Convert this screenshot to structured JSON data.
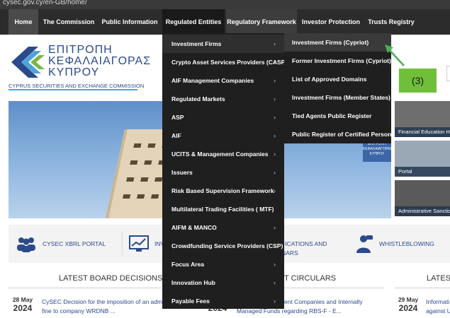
{
  "browser": {
    "url": "cysec.gov.cy/en-GB/home/"
  },
  "nav": {
    "items": [
      {
        "label": "Home"
      },
      {
        "label": "The Commission"
      },
      {
        "label": "Public Information"
      },
      {
        "label": "Regulated Entities"
      },
      {
        "label": "Regulatory Framework"
      },
      {
        "label": "Investor Protection"
      },
      {
        "label": "Trusts Registry"
      }
    ]
  },
  "logo": {
    "greek_line1": "ΕΠΙΤΡΟΠΗ",
    "greek_line2": "ΚΕΦΑΛΑΙΑΓΟΡΑΣ",
    "greek_line3": "ΚΥΠΡΟΥ",
    "english": "CYPRUS SECURITIES AND EXCHANGE COMMISSION",
    "colors": {
      "blue": "#2a4a8c",
      "green": "#7ab648",
      "light_blue": "#4fa3d8"
    }
  },
  "dropdown": {
    "items": [
      {
        "label": "Investment Firms",
        "chevron": "›"
      },
      {
        "label": "Crypto Asset Services Providers (CASP)",
        "chevron": "›"
      },
      {
        "label": "AIF Management Companies",
        "chevron": "›"
      },
      {
        "label": "Regulated Markets",
        "chevron": "›"
      },
      {
        "label": "ASP",
        "chevron": "›"
      },
      {
        "label": "AIF",
        "chevron": "›"
      },
      {
        "label": "UCITS & Management Companies",
        "chevron": "›"
      },
      {
        "label": "Issuers",
        "chevron": "›"
      },
      {
        "label": "Risk Based Supervision Framework",
        "chevron": "›"
      },
      {
        "label": "Multilateral Trading Facilities ( MTF)",
        "chevron": ""
      },
      {
        "label": "AIFM & MANCO",
        "chevron": "›"
      },
      {
        "label": "Crowdfunding Service Providers (CSP)",
        "chevron": "›"
      },
      {
        "label": "Focus Area",
        "chevron": "›"
      },
      {
        "label": "Innovation Hub",
        "chevron": "›"
      },
      {
        "label": "Payable Fees",
        "chevron": "›"
      }
    ]
  },
  "submenu": {
    "items": [
      {
        "label": "Investment Firms (Cypriot)",
        "chevron": ""
      },
      {
        "label": "Former Investment Firms (Cypriot)",
        "chevron": ""
      },
      {
        "label": "List of Approved Domains",
        "chevron": ""
      },
      {
        "label": "Investment Firms (Member States)",
        "chevron": "›"
      },
      {
        "label": "Tied Agents Public Register",
        "chevron": ""
      },
      {
        "label": "Public Register of Certified Persons",
        "chevron": ""
      }
    ]
  },
  "annotation": {
    "label": "(3)",
    "color": "#6fbf3a"
  },
  "hero": {
    "sign_text": "ΕΠΙΤΡΟΠΗ ΚΕΦΑΛΑΙΑΓΟΡΑΣ ΚΥΠΡΟΥ"
  },
  "side_tiles": [
    {
      "caption": "Financial Education Hu"
    },
    {
      "caption": "Portal"
    },
    {
      "caption": "Administrative Sanctio"
    }
  ],
  "quick_links": [
    {
      "label": "CYSEC XBRL PORTAL",
      "icon": "people-icon"
    },
    {
      "label": "INV",
      "icon": "chart-icon"
    },
    {
      "label_line1": "FICATIONS AND",
      "label_line2": "NARS",
      "icon": ""
    },
    {
      "label": "WHISTLEBLOWING",
      "icon": "whistleblower-icon"
    }
  ],
  "sections": {
    "board": {
      "title": "LATEST BOARD DECISIONS",
      "date_day": "28 May",
      "date_year": "2024",
      "line1": "CySEC Decision for the imposition of an admi",
      "line2": "fine to company WRDNB ..."
    },
    "circulars": {
      "title": "T CIRCULARS",
      "date_year": "2024",
      "line1": "ent Companies and Internally",
      "line2": "Managed Funds regarding RBS-F - E..."
    },
    "latest": {
      "title": "LATEST",
      "date_day": "29 May",
      "date_year": "2024",
      "line1": "Informati",
      "line2": "against U"
    }
  }
}
